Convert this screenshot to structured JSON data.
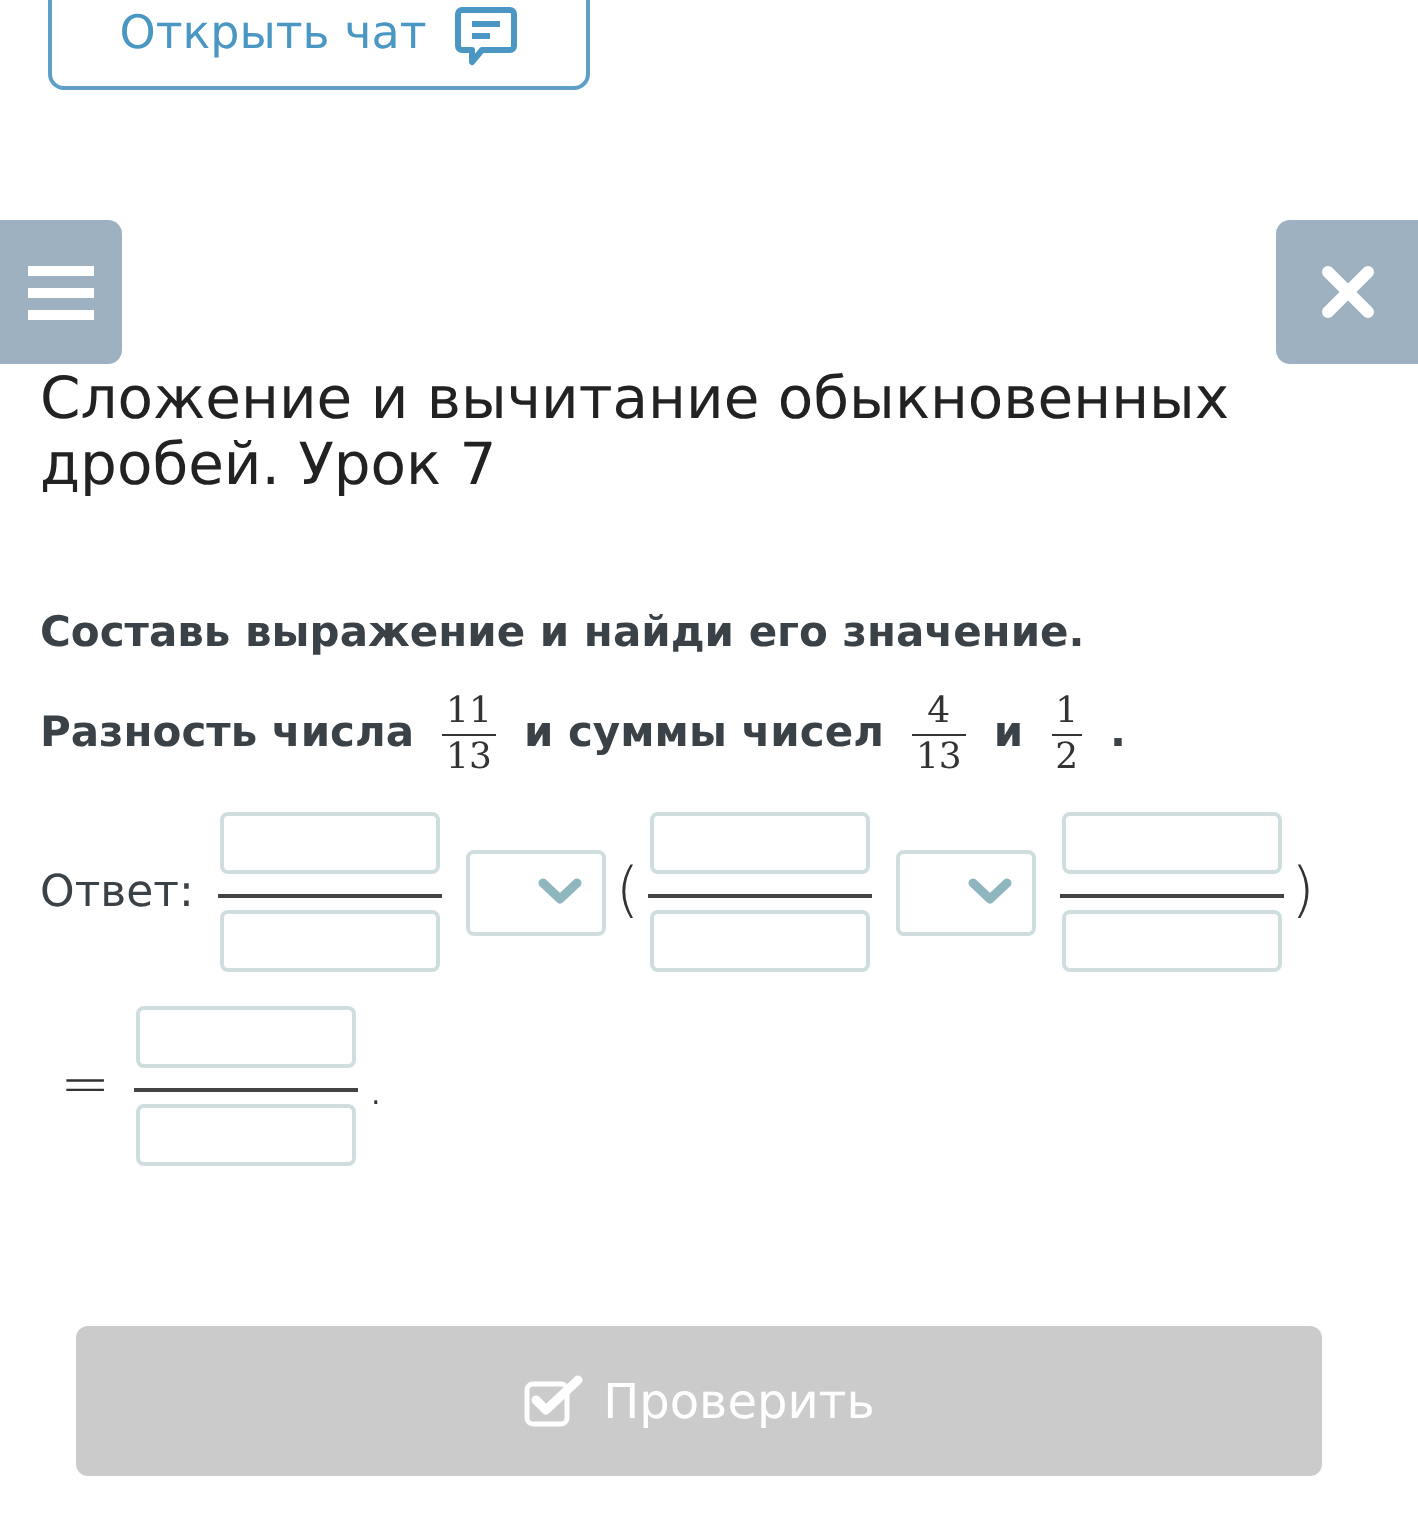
{
  "chat_button": {
    "label": "Открыть чат"
  },
  "lesson": {
    "title": "Сложение и вычитание обыкновенных дробей. Урок 7"
  },
  "task": {
    "instruction": "Составь выражение и найди его значение.",
    "statement": [
      {
        "kind": "text",
        "text": "Разность числа"
      },
      {
        "kind": "fraction",
        "numerator": "11",
        "denominator": "13"
      },
      {
        "kind": "text",
        "text": "и суммы чисел"
      },
      {
        "kind": "fraction",
        "numerator": "4",
        "denominator": "13"
      },
      {
        "kind": "text",
        "text": "и"
      },
      {
        "kind": "fraction",
        "numerator": "1",
        "denominator": "2"
      },
      {
        "kind": "text",
        "text": "."
      }
    ]
  },
  "answer": {
    "label": "Ответ:",
    "rows": [
      {
        "parts": [
          {
            "kind": "fraction_input"
          },
          {
            "kind": "dropdown"
          },
          {
            "kind": "symbol",
            "text": "("
          },
          {
            "kind": "fraction_input"
          },
          {
            "kind": "dropdown"
          },
          {
            "kind": "fraction_input"
          },
          {
            "kind": "symbol",
            "text": ")"
          }
        ]
      },
      {
        "parts": [
          {
            "kind": "symbol",
            "text": "="
          },
          {
            "kind": "fraction_input"
          },
          {
            "kind": "symbol",
            "text": "."
          }
        ]
      }
    ]
  },
  "check_button": {
    "label": "Проверить",
    "disabled": true
  }
}
